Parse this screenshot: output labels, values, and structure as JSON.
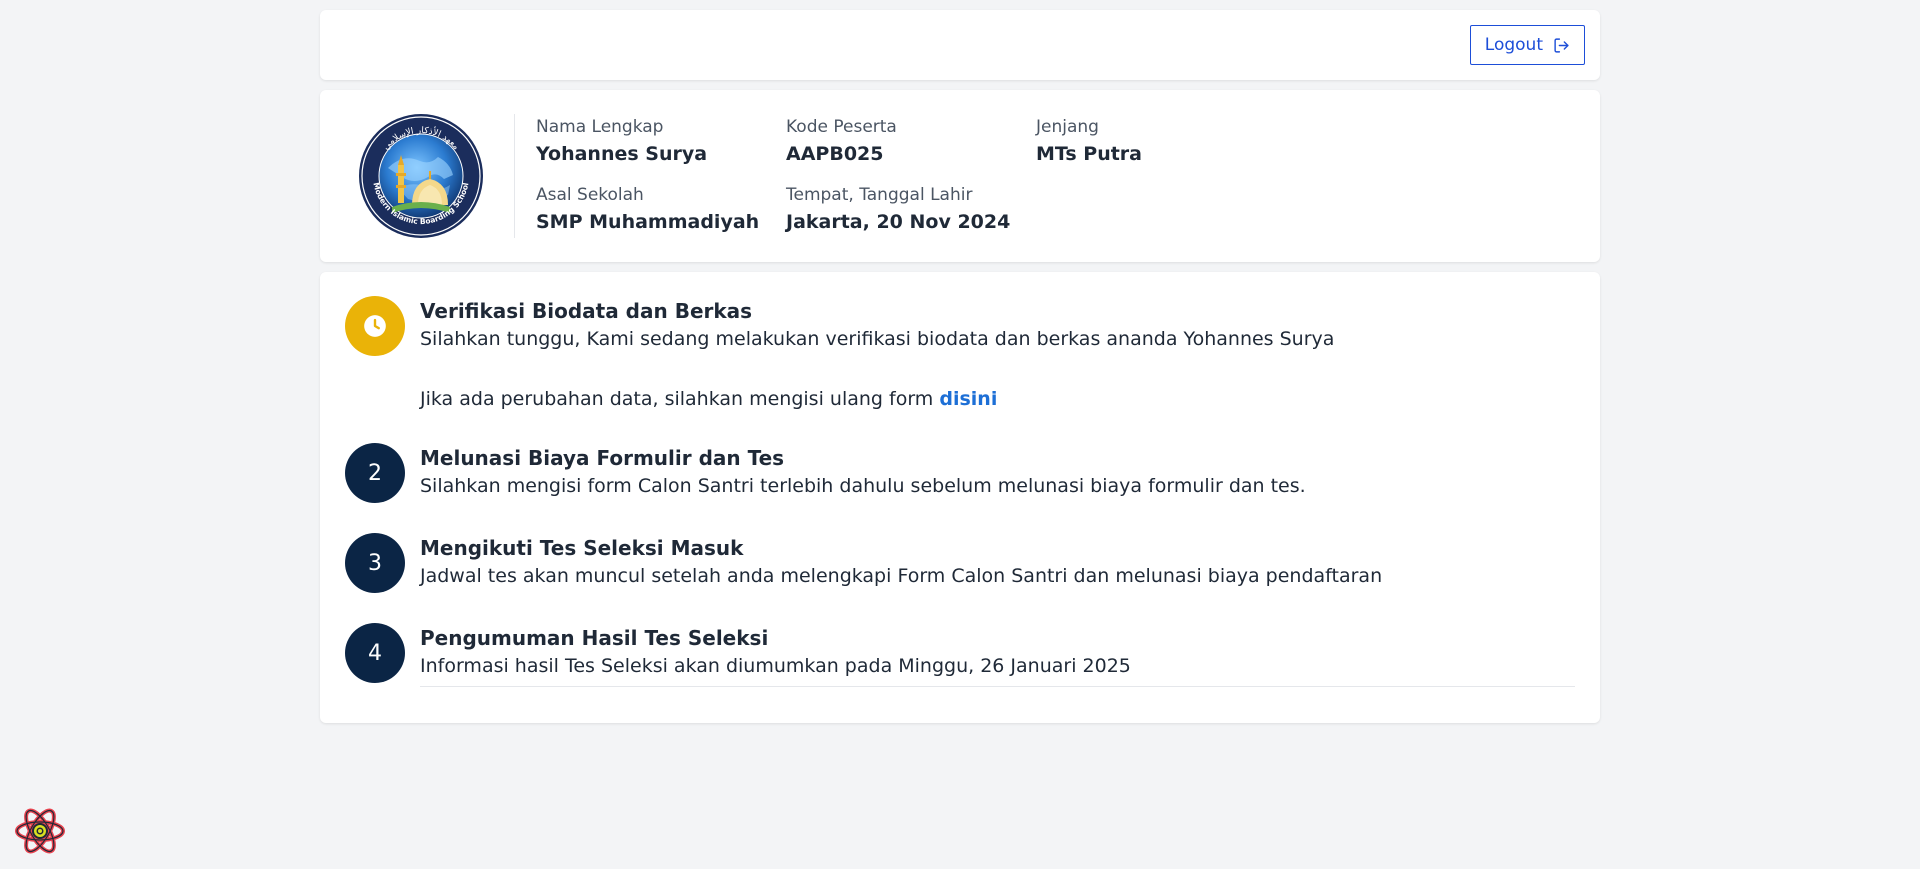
{
  "header": {
    "logout_label": "Logout"
  },
  "profile": {
    "logo": {
      "icon": "school-logo-icon",
      "arc_text_top": "معهد الأذكار الإسلامي",
      "arc_text_bottom": "Modern Islamic Boarding School"
    },
    "fields": [
      {
        "label": "Nama Lengkap",
        "value": "Yohannes Surya"
      },
      {
        "label": "Kode Peserta",
        "value": "AAPB025"
      },
      {
        "label": "Jenjang",
        "value": "MTs Putra"
      },
      {
        "label": "Asal Sekolah",
        "value": "SMP Muhammadiyah"
      },
      {
        "label": "Tempat, Tanggal Lahir",
        "value": "Jakarta, 20 Nov 2024"
      }
    ]
  },
  "steps": [
    {
      "badge": "",
      "icon": "clock-icon",
      "title": "Verifikasi Biodata dan Berkas",
      "desc": "Silahkan tunggu, Kami sedang melakukan verifikasi biodata dan berkas ananda Yohannes Surya",
      "extra_text": "Jika ada perubahan data, silahkan mengisi ulang form ",
      "extra_link": "disini"
    },
    {
      "badge": "2",
      "title": "Melunasi Biaya Formulir dan Tes",
      "desc": "Silahkan mengisi form Calon Santri terlebih dahulu sebelum melunasi biaya formulir dan tes."
    },
    {
      "badge": "3",
      "title": "Mengikuti Tes Seleksi Masuk",
      "desc": "Jadwal tes akan muncul setelah anda melengkapi Form Calon Santri dan melunasi biaya pendaftaran"
    },
    {
      "badge": "4",
      "title": "Pengumuman Hasil Tes Seleksi",
      "desc": "Informasi hasil Tes Seleksi akan diumumkan pada Minggu, 26 Januari 2025"
    }
  ],
  "colors": {
    "background": "#f3f4f6",
    "primary_blue": "#1d4ed8",
    "step_active": "#eab308",
    "step_pending": "#0b2545",
    "link": "#1d6fd6"
  },
  "devtool": {
    "icon": "react-devtools-icon"
  }
}
